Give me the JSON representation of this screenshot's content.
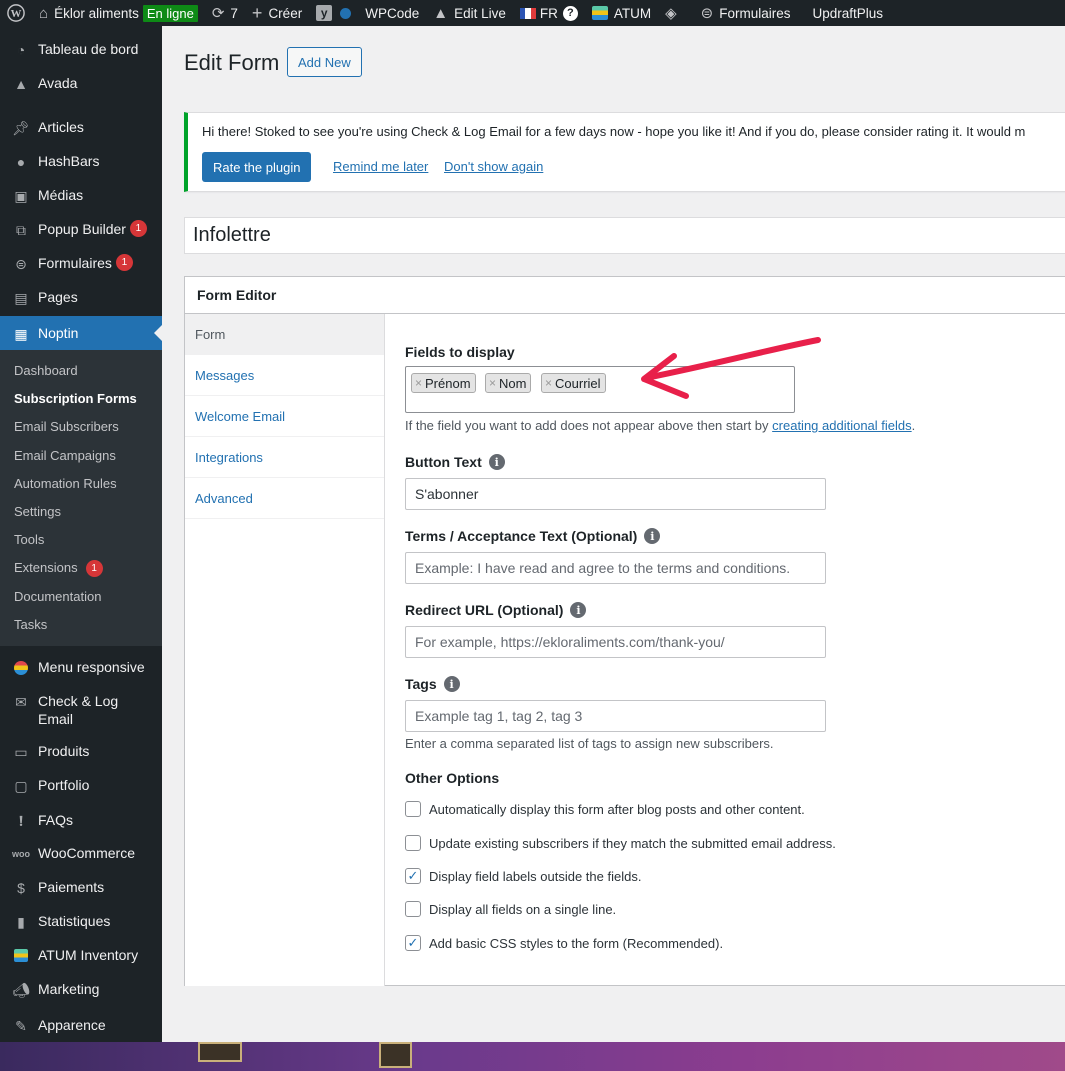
{
  "adminbar": {
    "site_name": "Éklor aliments",
    "status_badge": "En ligne",
    "updates_count": "7",
    "create_label": "Créer",
    "wpcode_label": "WPCode",
    "edit_live_label": "Edit Live",
    "lang_label": "FR",
    "help_label": "?",
    "atum_label": "ATUM",
    "forms_label": "Formulaires",
    "updraft_label": "UpdraftPlus"
  },
  "sidebar": {
    "top_items": [
      {
        "label": "Tableau de bord"
      },
      {
        "label": "Avada"
      },
      {
        "label": "Articles"
      },
      {
        "label": "HashBars"
      },
      {
        "label": "Médias"
      },
      {
        "label": "Popup Builder",
        "badge": "1"
      },
      {
        "label": "Formulaires",
        "badge": "1"
      },
      {
        "label": "Pages"
      },
      {
        "label": "Noptin"
      }
    ],
    "submenu": [
      {
        "label": "Dashboard"
      },
      {
        "label": "Subscription Forms"
      },
      {
        "label": "Email Subscribers"
      },
      {
        "label": "Email Campaigns"
      },
      {
        "label": "Automation Rules"
      },
      {
        "label": "Settings"
      },
      {
        "label": "Tools"
      },
      {
        "label": "Extensions",
        "badge": "1"
      },
      {
        "label": "Documentation"
      },
      {
        "label": "Tasks"
      }
    ],
    "bottom_items": [
      {
        "label": "Menu responsive"
      },
      {
        "label": "Check & Log Email"
      },
      {
        "label": "Produits"
      },
      {
        "label": "Portfolio"
      },
      {
        "label": "FAQs"
      },
      {
        "label": "WooCommerce"
      },
      {
        "label": "Paiements"
      },
      {
        "label": "Statistiques"
      },
      {
        "label": "ATUM Inventory"
      },
      {
        "label": "Marketing"
      },
      {
        "label": "Apparence"
      }
    ]
  },
  "page": {
    "title": "Edit Form",
    "add_new_label": "Add New"
  },
  "notice": {
    "text": "Hi there! Stoked to see you're using Check & Log Email for a few days now - hope you like it! And if you do, please consider rating it. It would m",
    "rate_label": "Rate the plugin",
    "remind_label": "Remind me later",
    "dont_show_label": "Don't show again"
  },
  "form": {
    "title_value": "Infolettre",
    "editor_heading": "Form Editor",
    "tabs": [
      {
        "label": "Form"
      },
      {
        "label": "Messages"
      },
      {
        "label": "Welcome Email"
      },
      {
        "label": "Integrations"
      },
      {
        "label": "Advanced"
      }
    ],
    "fields_label": "Fields to display",
    "fields": [
      "Prénom",
      "Nom",
      "Courriel"
    ],
    "fields_help_prefix": "If the field you want to add does not appear above then start by",
    "fields_help_link": "creating additional fields",
    "button_text_label": "Button Text",
    "button_text_value": "S'abonner",
    "terms_label": "Terms / Acceptance Text (Optional)",
    "terms_placeholder": "Example: I have read and agree to the terms and conditions.",
    "redirect_label": "Redirect URL (Optional)",
    "redirect_placeholder": "For example, https://ekloraliments.com/thank-you/",
    "tags_label": "Tags",
    "tags_placeholder": "Example tag 1, tag 2, tag 3",
    "tags_help": "Enter a comma separated list of tags to assign new subscribers.",
    "other_options_label": "Other Options",
    "options": [
      {
        "label": "Automatically display this form after blog posts and other content.",
        "checked": false
      },
      {
        "label": "Update existing subscribers if they match the submitted email address.",
        "checked": false
      },
      {
        "label": "Display field labels outside the fields.",
        "checked": true
      },
      {
        "label": "Display all fields on a single line.",
        "checked": false
      },
      {
        "label": "Add basic CSS styles to the form (Recommended).",
        "checked": true
      }
    ]
  },
  "colors": {
    "accent": "#2271b1",
    "annotation_arrow": "#e8204a",
    "notice_border": "#00a32a"
  }
}
